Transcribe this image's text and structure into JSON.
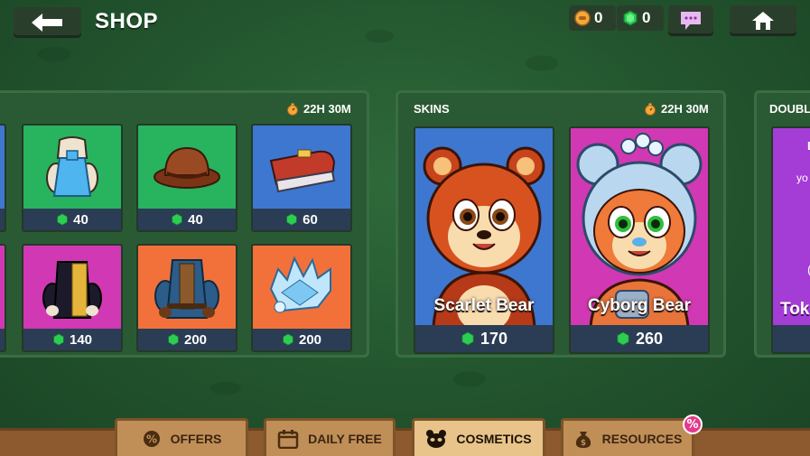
{
  "header": {
    "title": "SHOP",
    "coins": "0",
    "gems": "0"
  },
  "cosmetics_panel": {
    "timer": "22H 30M",
    "items": [
      {
        "price": "40"
      },
      {
        "price": "40"
      },
      {
        "price": "60"
      },
      {
        "price": "140"
      },
      {
        "price": "200"
      },
      {
        "price": "200"
      }
    ]
  },
  "skins_panel": {
    "title": "SKINS",
    "timer": "22H 30M",
    "skins": [
      {
        "name": "Scarlet Bear",
        "price": "170"
      },
      {
        "name": "Cyborg Bear",
        "price": "260"
      }
    ]
  },
  "double_panel": {
    "title": "DOUBLE",
    "text_lines": [
      "D",
      "yo",
      "(",
      "Toke"
    ]
  },
  "tabs": [
    {
      "label": "OFFERS"
    },
    {
      "label": "DAILY FREE"
    },
    {
      "label": "COSMETICS"
    },
    {
      "label": "RESOURCES"
    }
  ],
  "resources_badge": "%",
  "colors": {
    "gem": "#2ecc52",
    "coin": "#f2a93a",
    "price_bar": "#2b3c55"
  }
}
